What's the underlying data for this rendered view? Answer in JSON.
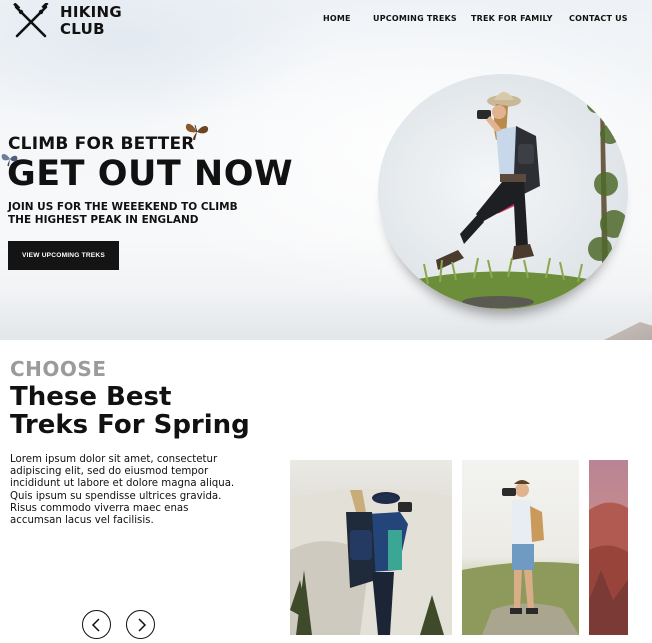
{
  "brand": {
    "name_line1": "HIKING",
    "name_line2": "CLUB",
    "icon": "crossed-trekking-poles-icon"
  },
  "nav": {
    "items": [
      "HOME",
      "UPCOMING TREKS",
      "TREK FOR FAMILY",
      "CONTACT US"
    ]
  },
  "hero": {
    "kicker": "CLIMB FOR BETTER",
    "headline": "GET OUT NOW",
    "sub_line1": "JOIN US FOR THE WEEEKEND TO CLIMB",
    "sub_line2": "THE HIGHEST PEAK IN ENGLAND",
    "cta": "VIEW UPCOMING TREKS"
  },
  "treks": {
    "eyebrow": "CHOOSE",
    "title_line1": "These Best",
    "title_line2": "Treks For Spring",
    "description": "Lorem ipsum dolor sit amet, consectetur adipiscing elit, sed do eiusmod tempor incididunt ut labore et dolore magna aliqua. Quis ipsum su spendisse ultrices gravida. Risus commodo viverra maec enas accumsan lacus vel facilisis.",
    "prev_icon": "chevron-left-icon",
    "next_icon": "chevron-right-icon"
  },
  "colors": {
    "button_bg": "#141414",
    "eyebrow": "#9b9b9b",
    "text": "#111111"
  }
}
